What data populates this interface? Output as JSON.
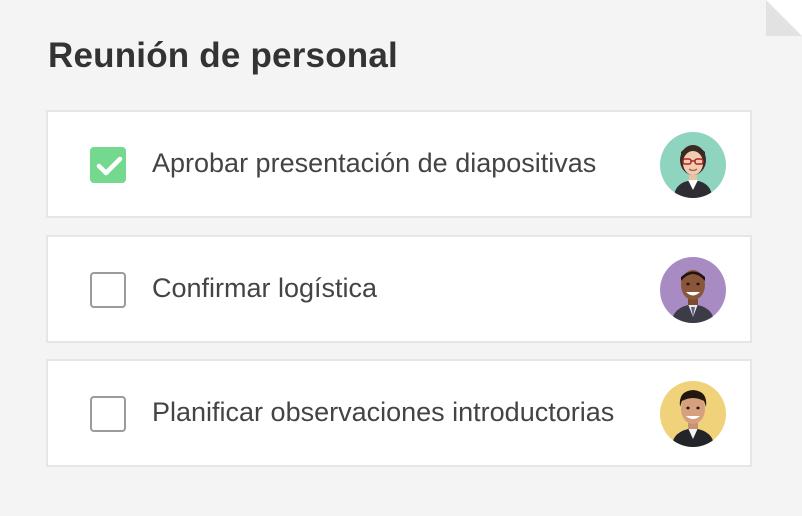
{
  "title": "Reunión de personal",
  "tasks": [
    {
      "label": "Aprobar presentación de diapositivas",
      "checked": true,
      "avatar_bg": "#8fd4bf"
    },
    {
      "label": "Confirmar logística",
      "checked": false,
      "avatar_bg": "#a98bc4"
    },
    {
      "label": "Planificar observaciones introductorias",
      "checked": false,
      "avatar_bg": "#f0d27a"
    }
  ],
  "colors": {
    "check": "#74d88e",
    "border": "#e6e6e6",
    "background": "#f4f4f4"
  }
}
